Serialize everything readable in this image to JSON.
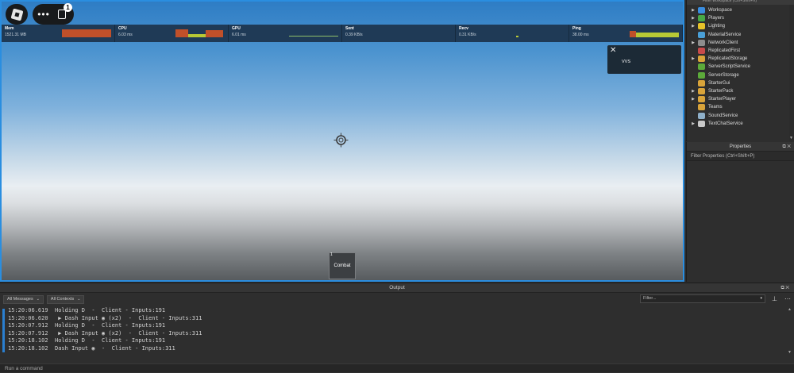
{
  "topbar": {
    "badge_count": "1",
    "more_glyph": "•••"
  },
  "stats": [
    {
      "name": "Mem",
      "value": "1521.31 MB"
    },
    {
      "name": "CPU",
      "value": "6.03 ms"
    },
    {
      "name": "GPU",
      "value": "6.01 ms"
    },
    {
      "name": "Sent",
      "value": "0.39 KB/s"
    },
    {
      "name": "Recv",
      "value": "0.31 KB/s"
    },
    {
      "name": "Ping",
      "value": "38.00 ms"
    }
  ],
  "popup": {
    "close_glyph": "✕",
    "text": "VVS"
  },
  "combat": {
    "label": "Combat",
    "key": "1"
  },
  "explorer": {
    "filter_placeholder": "Filter workspace (Ctrl+Shift+X)",
    "items": [
      {
        "label": "Workspace",
        "arrow": "▶",
        "icon": "workspace-icon",
        "color": "#3a8de0"
      },
      {
        "label": "Players",
        "arrow": "▶",
        "icon": "players-icon",
        "color": "#47a846"
      },
      {
        "label": "Lighting",
        "arrow": "▶",
        "icon": "lighting-icon",
        "color": "#e6c229"
      },
      {
        "label": "MaterialService",
        "arrow": "",
        "icon": "material-service-icon",
        "color": "#4aa0d8"
      },
      {
        "label": "NetworkClient",
        "arrow": "▶",
        "icon": "network-client-icon",
        "color": "#8d8d8d"
      },
      {
        "label": "ReplicatedFirst",
        "arrow": "",
        "icon": "replicated-first-icon",
        "color": "#c84b4b"
      },
      {
        "label": "ReplicatedStorage",
        "arrow": "▶",
        "icon": "replicated-storage-icon",
        "color": "#d9a43a"
      },
      {
        "label": "ServerScriptService",
        "arrow": "",
        "icon": "server-script-service-icon",
        "color": "#5caa3a"
      },
      {
        "label": "ServerStorage",
        "arrow": "",
        "icon": "server-storage-icon",
        "color": "#5caa3a"
      },
      {
        "label": "StarterGui",
        "arrow": "",
        "icon": "starter-gui-icon",
        "color": "#d9a43a"
      },
      {
        "label": "StarterPack",
        "arrow": "▶",
        "icon": "starter-pack-icon",
        "color": "#d9a43a"
      },
      {
        "label": "StarterPlayer",
        "arrow": "▶",
        "icon": "starter-player-icon",
        "color": "#d9a43a"
      },
      {
        "label": "Teams",
        "arrow": "",
        "icon": "teams-icon",
        "color": "#d9a43a"
      },
      {
        "label": "SoundService",
        "arrow": "",
        "icon": "sound-service-icon",
        "color": "#8fb0c9"
      },
      {
        "label": "TextChatService",
        "arrow": "▶",
        "icon": "text-chat-service-icon",
        "color": "#c9c9c9"
      }
    ]
  },
  "properties": {
    "title": "Properties",
    "filter_placeholder": "Filter Properties (Ctrl+Shift+P)"
  },
  "output": {
    "title": "Output",
    "messages_filter": "All Messages",
    "contexts_filter": "All Contexts",
    "search_placeholder": "Filter...",
    "logs": [
      {
        "time": "15:20:06.619",
        "text": "  Holding D  -  Client - Inputs:191"
      },
      {
        "time": "15:20:06.620",
        "text": "   ▶ Dash Input ◉ (x2)  -  Client - Inputs:311"
      },
      {
        "time": "15:20:07.912",
        "text": "  Holding D  -  Client - Inputs:191"
      },
      {
        "time": "15:20:07.912",
        "text": "   ▶ Dash Input ◉ (x2)  -  Client - Inputs:311"
      },
      {
        "time": "15:20:18.102",
        "text": "  Holding D  -  Client - Inputs:191"
      },
      {
        "time": "15:20:18.102",
        "text": "  Dash Input ◉  -  Client - Inputs:311"
      }
    ],
    "command_placeholder": "Run a command"
  },
  "colors": {
    "accent": "#2a8ee0",
    "stats_bg": "#1f3a56",
    "panel_bg": "#2e2e2e"
  }
}
